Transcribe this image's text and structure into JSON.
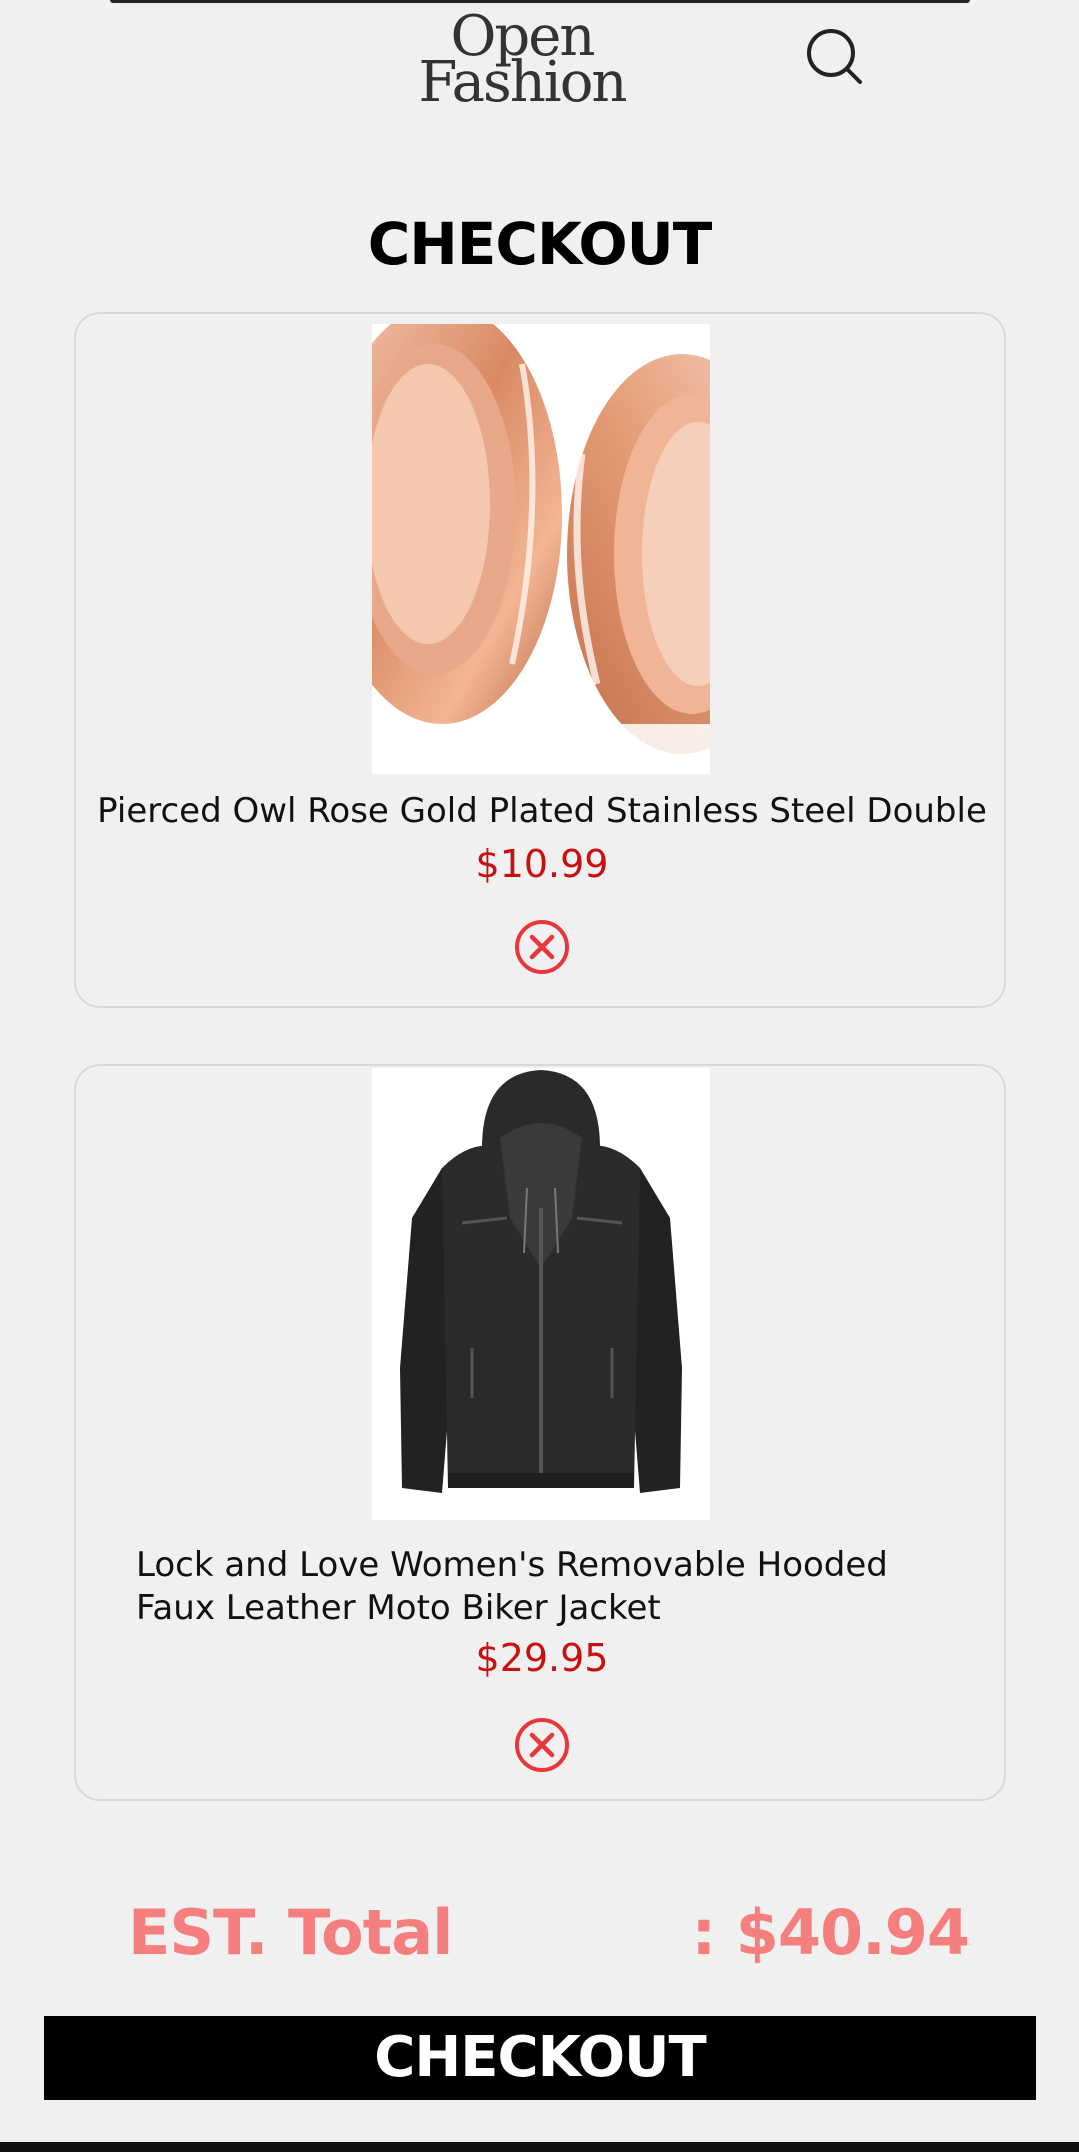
{
  "header": {
    "logo_line1": "Open",
    "logo_line2": "Fashion",
    "search_icon": "search-icon"
  },
  "page": {
    "title": "CHECKOUT"
  },
  "cart": {
    "items": [
      {
        "title": "Pierced Owl Rose Gold Plated Stainless Steel Double",
        "price": "$10.99",
        "image": "rose-gold-flare-tunnel-plugs",
        "remove_icon": "remove-circle-x-icon"
      },
      {
        "title": "Lock and Love Women's Removable Hooded Faux Leather Moto Biker Jacket",
        "price": "$29.95",
        "image": "black-hooded-leather-jacket",
        "remove_icon": "remove-circle-x-icon"
      }
    ]
  },
  "summary": {
    "total_label": "EST. Total",
    "total_value": ": $40.94",
    "checkout_label": "CHECKOUT"
  },
  "colors": {
    "price": "#c91010",
    "total": "#f57f7f",
    "button_bg": "#000000"
  }
}
